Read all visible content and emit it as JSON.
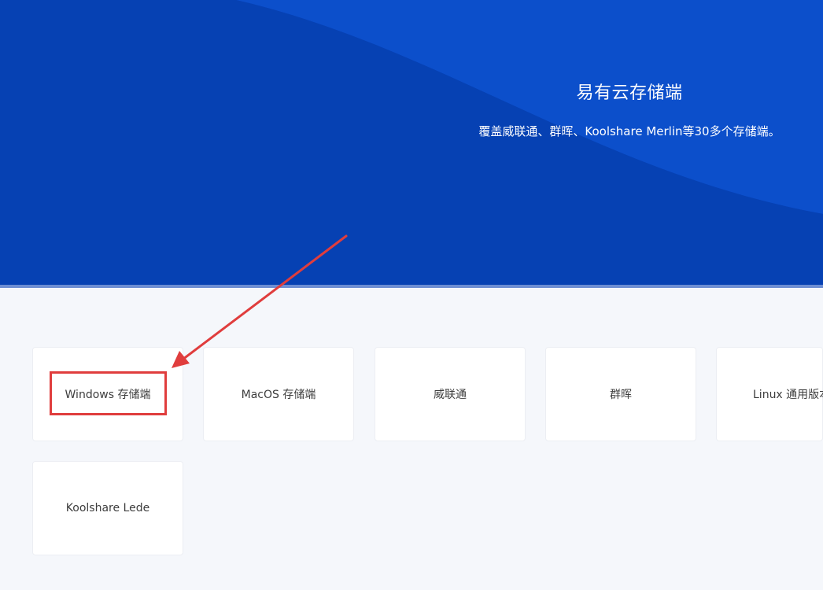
{
  "hero": {
    "title": "易有云存储端",
    "subtitle": "覆盖威联通、群晖、Koolshare Merlin等30多个存储端。"
  },
  "cards": [
    {
      "label": "Windows 存储端"
    },
    {
      "label": "MacOS 存储端"
    },
    {
      "label": "威联通"
    },
    {
      "label": "群晖"
    },
    {
      "label": "Linux 通用版本"
    },
    {
      "label": "Koolshare Lede"
    }
  ],
  "colors": {
    "hero_blue": "#0a49c2",
    "annotation_red": "#e03d3d",
    "page_bg": "#f5f7fb"
  }
}
